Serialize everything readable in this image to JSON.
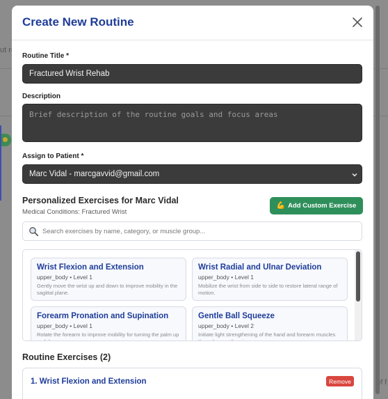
{
  "background": {
    "left_fragment": "ut ro",
    "right_fragment": "ef f"
  },
  "modal": {
    "title": "Create New Routine"
  },
  "form": {
    "title_label": "Routine Title *",
    "title_value": "Fractured Wrist Rehab",
    "description_label": "Description",
    "description_placeholder": "Brief description of the routine goals and focus areas",
    "patient_label": "Assign to Patient *",
    "patient_value": "Marc Vidal - marcgavvid@gmail.com"
  },
  "exercises_section": {
    "title": "Personalized Exercises for Marc Vidal",
    "subtitle": "Medical Conditions: Fractured Wrist",
    "add_button_emoji": "💪",
    "add_button_label": "Add Custom Exercise",
    "search_placeholder": "Search exercises by name, category, or muscle group...",
    "items": [
      {
        "name": "Wrist Flexion and Extension",
        "meta": "upper_body • Level 1",
        "description": "Gently move the wrist up and down to improve mobility in the sagittal plane."
      },
      {
        "name": "Wrist Radial and Ulnar Deviation",
        "meta": "upper_body • Level 1",
        "description": "Mobilize the wrist from side to side to restore lateral range of motion."
      },
      {
        "name": "Forearm Pronation and Supination",
        "meta": "upper_body • Level 1",
        "description": "Rotate the forearm to improve mobility for turning the palm up and down."
      },
      {
        "name": "Gentle Ball Squeeze",
        "meta": "upper_body • Level 2",
        "description": "Initiate light strengthening of the hand and forearm muscles through a gentle grip."
      }
    ]
  },
  "routine": {
    "title": "Routine Exercises (2)",
    "items": [
      {
        "name": "1. Wrist Flexion and Extension",
        "remove_label": "Remove"
      }
    ]
  },
  "colors": {
    "accent": "#1f3d99",
    "success": "#2f8f5b",
    "danger": "#d9463e",
    "input_bg": "#3b3b3b"
  }
}
